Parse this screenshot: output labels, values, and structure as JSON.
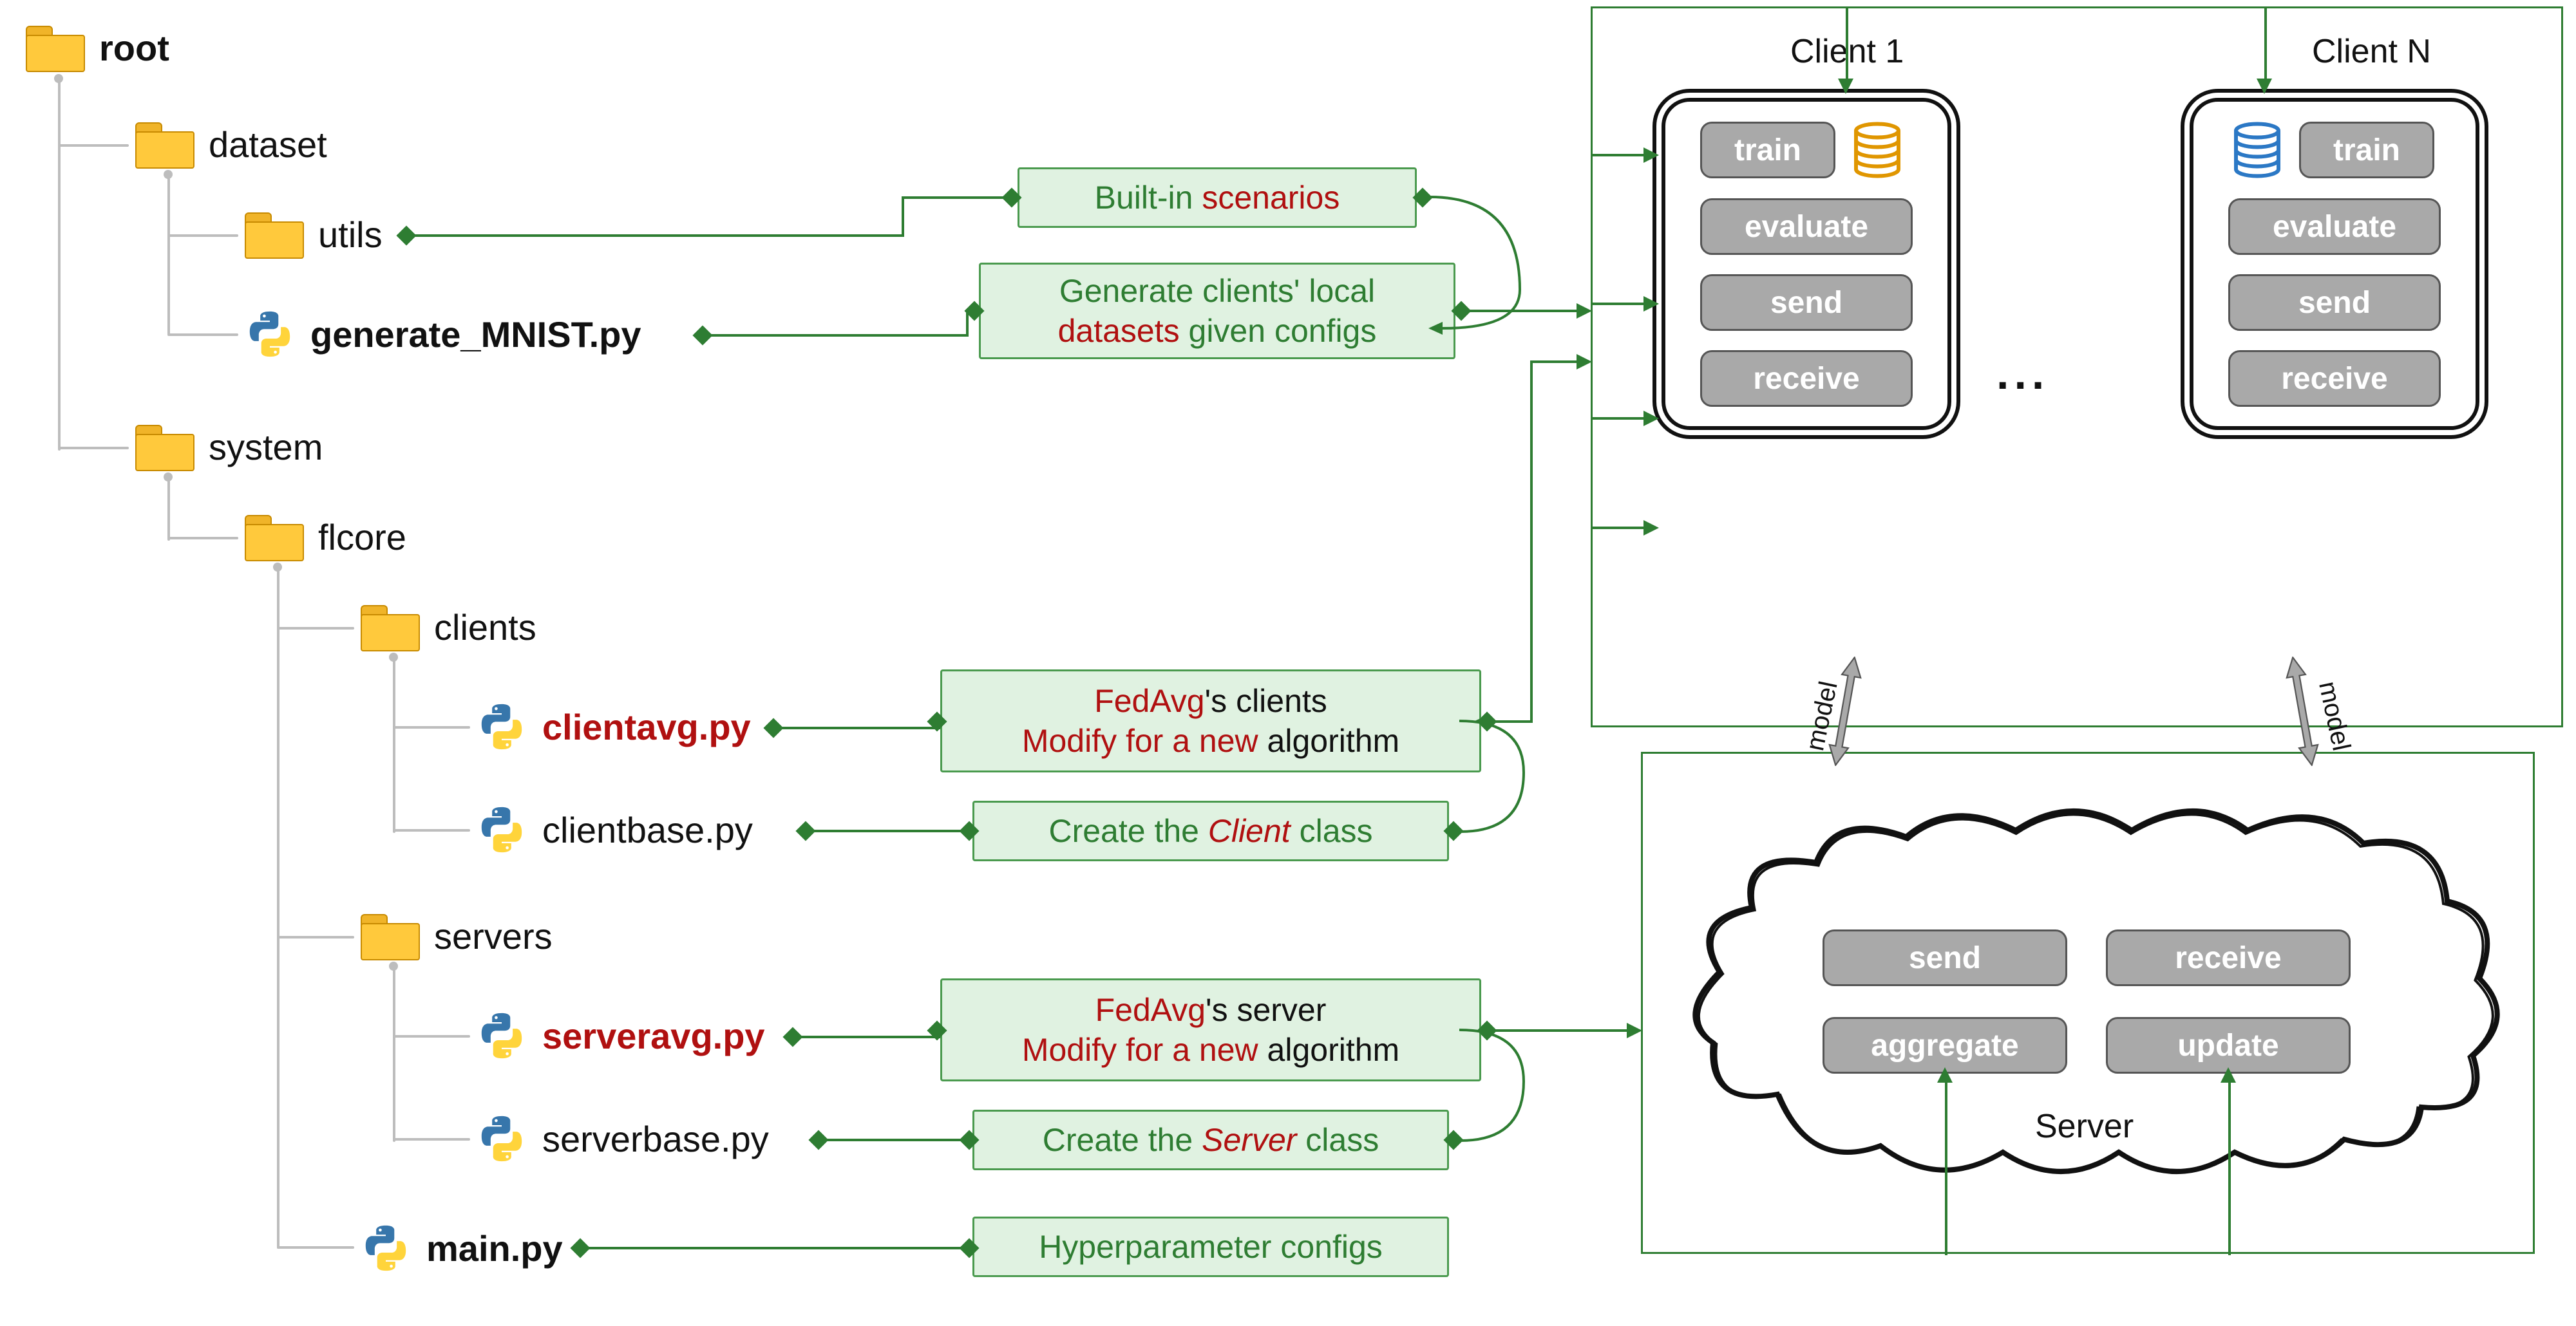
{
  "tree": {
    "root": "root",
    "dataset": "dataset",
    "utils": "utils",
    "generate_mnist": "generate_MNIST.py",
    "system": "system",
    "flcore": "flcore",
    "clients": "clients",
    "clientavg": "clientavg.py",
    "clientbase": "clientbase.py",
    "servers": "servers",
    "serveravg": "serveravg.py",
    "serverbase": "serverbase.py",
    "main": "main.py"
  },
  "desc": {
    "utils_1a": "Built-in ",
    "utils_1b": "scenarios",
    "genmnist_1": "Generate clients' local",
    "genmnist_2a": "datasets",
    "genmnist_2b": " given configs",
    "clientavg_1a": "FedAvg",
    "clientavg_1b": "'s clients",
    "clientavg_2a": "Modify for a new ",
    "clientavg_2b": "algorithm",
    "clientbase_1a": "Create the ",
    "clientbase_1b": "Client",
    "clientbase_1c": " class",
    "serveravg_1a": "FedAvg",
    "serveravg_1b": "'s server",
    "serveravg_2a": "Modify for a new ",
    "serveravg_2b": "algorithm",
    "serverbase_1a": "Create the ",
    "serverbase_1b": "Server",
    "serverbase_1c": " class",
    "main_1": "Hyperparameter configs"
  },
  "arch": {
    "client1": "Client 1",
    "clientN": "Client N",
    "train": "train",
    "evaluate": "evaluate",
    "send": "send",
    "receive": "receive",
    "aggregate": "aggregate",
    "update": "update",
    "server": "Server",
    "model": "model",
    "ellipsis": "..."
  },
  "colors": {
    "green": "#2e7d32",
    "lightgreen": "#e0f2e1",
    "red": "#b01010",
    "gray": "#a9a9a9",
    "folder": "#ffc93c",
    "treeline": "#bdbdbd",
    "db_orange": "#e09600",
    "db_blue": "#2b78c5"
  }
}
